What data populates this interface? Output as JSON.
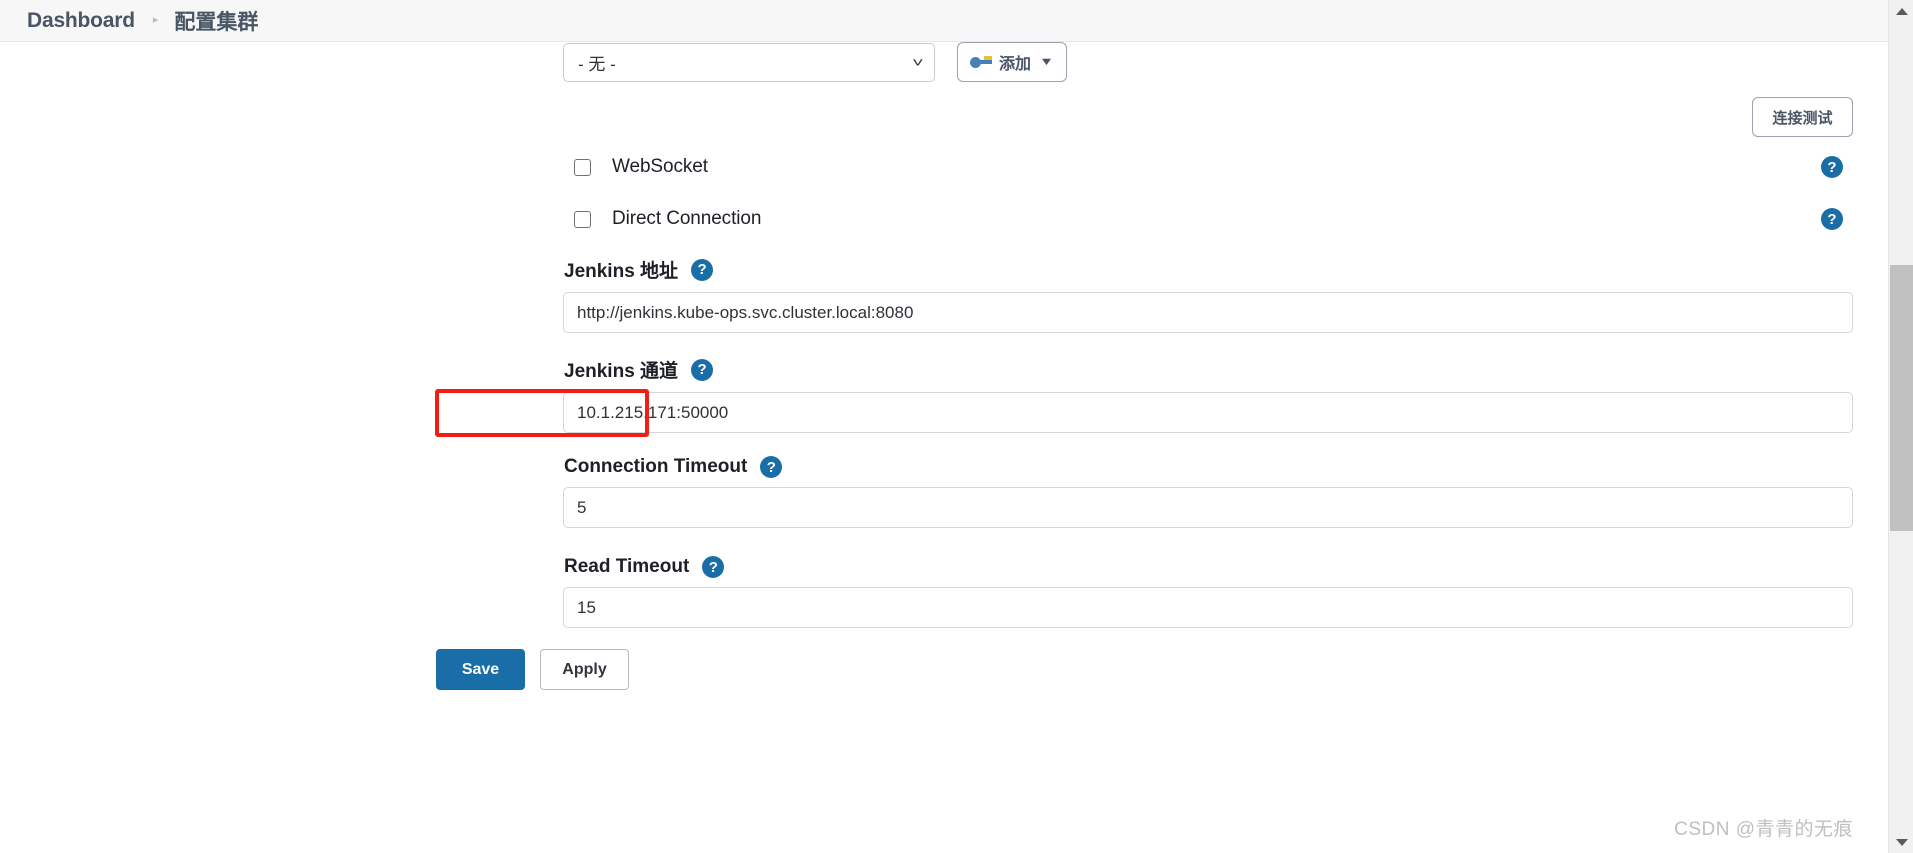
{
  "header": {
    "breadcrumb_root": "Dashboard",
    "breadcrumb_separator": "▸",
    "breadcrumb_current": "配置集群"
  },
  "form": {
    "credentials_select": {
      "value": "- 无 -",
      "caret_icon": "chevron-down-icon"
    },
    "add_button": {
      "label": "添加",
      "icon": "key-icon",
      "caret_icon": "caret-down-icon"
    },
    "test_connection_button": {
      "label": "连接测试"
    },
    "checkboxes": [
      {
        "label": "WebSocket",
        "checked": false,
        "help_icon": "help-circle-icon"
      },
      {
        "label": "Direct Connection",
        "checked": false,
        "help_icon": "help-circle-icon"
      }
    ],
    "fields": [
      {
        "key": "jenkins_url",
        "label": "Jenkins 地址",
        "value": "http://jenkins.kube-ops.svc.cluster.local:8080",
        "help_icon": "help-circle-icon"
      },
      {
        "key": "jenkins_tunnel",
        "label": "Jenkins 通道",
        "value": "10.1.215.171:50000",
        "help_icon": "help-circle-icon",
        "highlighted": true
      },
      {
        "key": "connection_timeout",
        "label": "Connection Timeout",
        "value": "5",
        "help_icon": "help-circle-icon"
      },
      {
        "key": "read_timeout",
        "label": "Read Timeout",
        "value": "15",
        "help_icon": "help-circle-icon"
      }
    ],
    "actions": {
      "save_label": "Save",
      "apply_label": "Apply"
    }
  },
  "scrollbar": {
    "up_arrow_icon": "triangle-up-icon",
    "down_arrow_icon": "triangle-down-icon"
  },
  "watermark": {
    "text": "CSDN @青青的无痕"
  },
  "colors": {
    "accent_blue": "#1a6ea8",
    "annotation_red": "#f01e14",
    "header_bg": "#f7f7f8",
    "text_dark": "#1d2026",
    "crumb_text": "#4a5565"
  },
  "help_glyph": "?"
}
